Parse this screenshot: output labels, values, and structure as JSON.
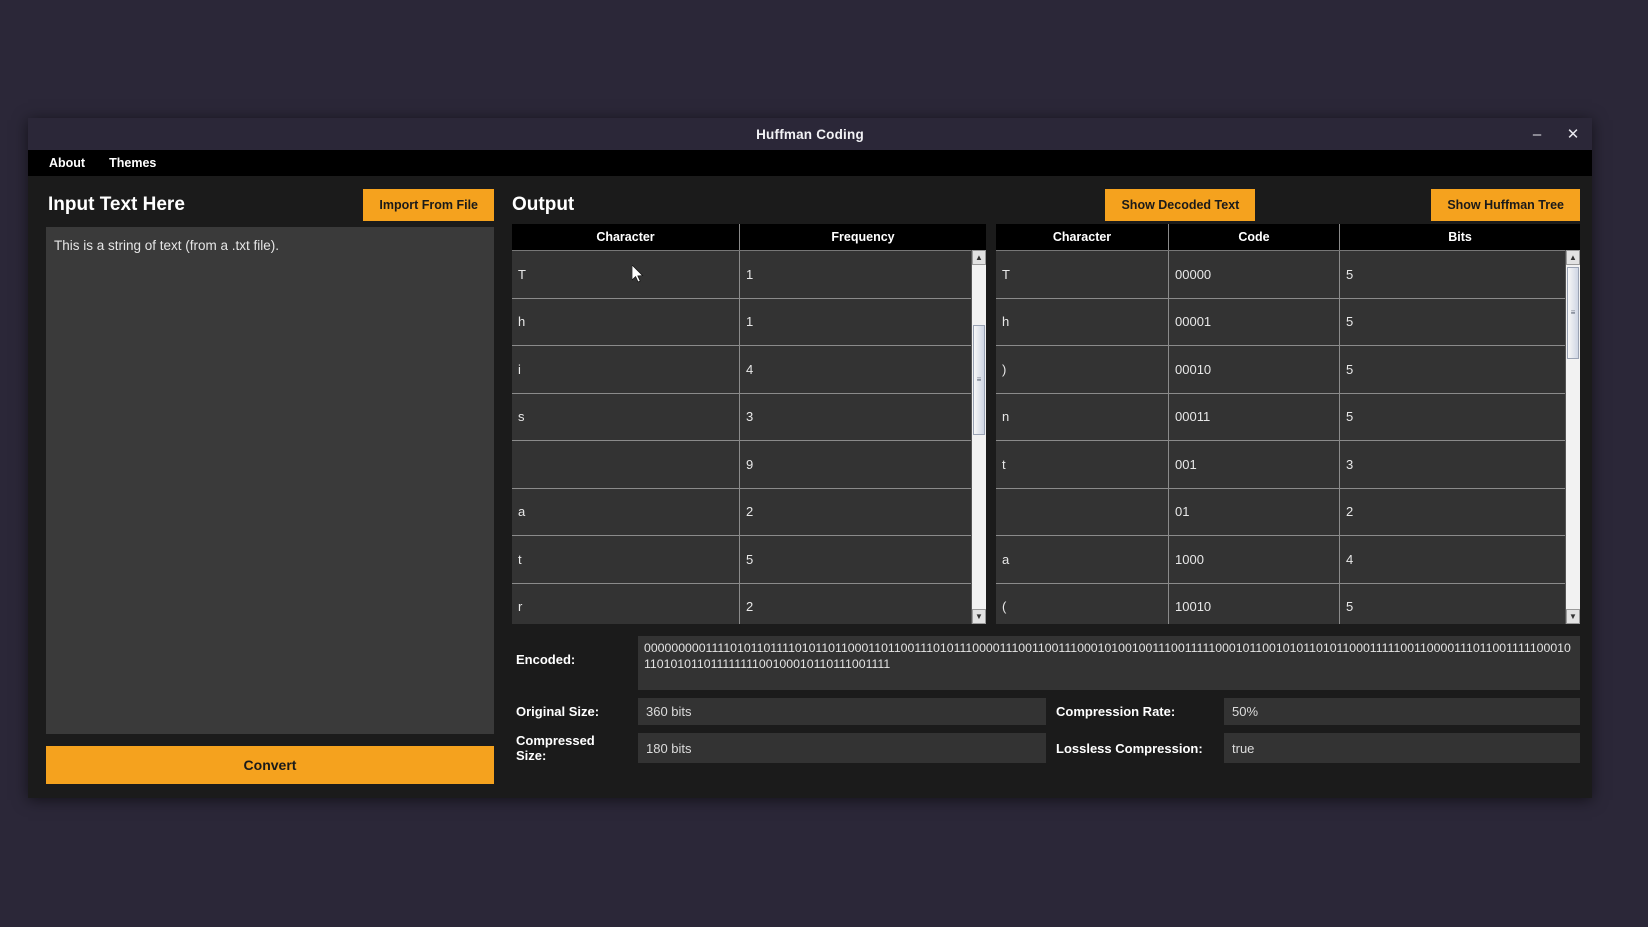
{
  "window": {
    "title": "Huffman Coding",
    "controls": {
      "minimize": "‒",
      "close": "✕"
    },
    "menu": [
      {
        "label": "About"
      },
      {
        "label": "Themes"
      }
    ]
  },
  "colors": {
    "accent": "#f5a21e",
    "window_bg": "#1b1b1b",
    "titlebar_bg": "#2b2738",
    "menubar_bg": "#000000",
    "table_header_bg": "#000000",
    "table_row_bg": "#333333",
    "desktop_bg": "#2b2738",
    "text": "#ffffff"
  },
  "left_panel": {
    "title": "Input Text Here",
    "import_button": "Import From File",
    "input_value": "This is a string of text (from a .txt file).",
    "input_placeholder": "",
    "convert_button": "Convert"
  },
  "right_panel": {
    "title": "Output",
    "show_decoded_button": "Show Decoded Text",
    "show_tree_button": "Show Huffman Tree",
    "frequency_table": {
      "columns": [
        "Character",
        "Frequency"
      ],
      "rows": [
        [
          "T",
          "1"
        ],
        [
          "h",
          "1"
        ],
        [
          "i",
          "4"
        ],
        [
          "s",
          "3"
        ],
        [
          "",
          "9"
        ],
        [
          "a",
          "2"
        ],
        [
          "t",
          "5"
        ],
        [
          "r",
          "2"
        ]
      ]
    },
    "codes_table": {
      "columns": [
        "Character",
        "Code",
        "Bits"
      ],
      "rows": [
        [
          "T",
          "00000",
          "5"
        ],
        [
          "h",
          "00001",
          "5"
        ],
        [
          ")",
          "00010",
          "5"
        ],
        [
          "n",
          "00011",
          "5"
        ],
        [
          "t",
          "001",
          "3"
        ],
        [
          "",
          "01",
          "2"
        ],
        [
          "a",
          "1000",
          "4"
        ],
        [
          "(",
          "10010",
          "5"
        ]
      ]
    }
  },
  "stats": {
    "encoded_label": "Encoded:",
    "encoded_value": "00000000011110101101111010110110001101100111010111000011100110011100010100100111001111100010110010101101011000111110011000011101100111110001011010101101111111100100010110111001111",
    "original_size_label": "Original Size:",
    "original_size_value": "360 bits",
    "compressed_size_label": "Compressed Size:",
    "compressed_size_value": "180 bits",
    "compression_rate_label": "Compression Rate:",
    "compression_rate_value": "50%",
    "lossless_label": "Lossless Compression:",
    "lossless_value": "true"
  },
  "scrollbars": {
    "up_arrow": "▲",
    "down_arrow": "▼",
    "grip": "≡"
  }
}
